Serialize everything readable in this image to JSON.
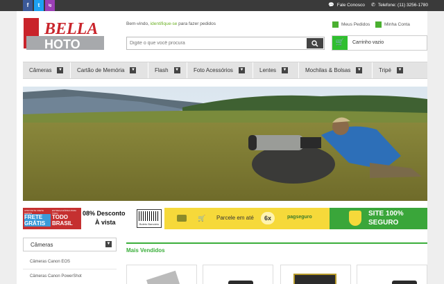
{
  "topbar": {
    "social": [
      "f",
      "t",
      "ig"
    ],
    "contact_label": "Fale Conosco",
    "phone_label": "Telefone: (11) 3256-1780"
  },
  "header": {
    "logo_text_top": "BELLA",
    "logo_text_bottom": "HOTO",
    "welcome_prefix": "Bem-vindo,",
    "welcome_link": "identifique-se",
    "welcome_suffix": "para fazer pedidos",
    "search_placeholder": "Digite o que você procura",
    "my_orders": "Meus Pedidos",
    "my_account": "Minha Conta",
    "cart_label": "Carrinho vazio"
  },
  "nav": {
    "items": [
      "Câmeras",
      "Cartão de Memória",
      "Flash",
      "Foto Acessórios",
      "Lentes",
      "Mochilas & Bolsas",
      "Tripé"
    ]
  },
  "strip": {
    "frete_top": "APROVEITE FRETE GRÁTIS",
    "frete": "FRETE GRÁTIS",
    "brasil_top": "ENTREGA RÁPIDA PARA TODO",
    "brasil": "TODO BRASIL",
    "desconto": "08% Desconto",
    "avista": "À vista",
    "boleto": "Boleto Bancário",
    "parcele": "Parcele em até",
    "parcelas": "6x",
    "pagseguro": "pagseguro",
    "site_line1": "SITE 100%",
    "site_line2": "SEGURO"
  },
  "sidebar": {
    "title": "Câmeras",
    "items": [
      "Câmeras Canon EOS",
      "Câmeras Canon PowerShot"
    ]
  },
  "products": {
    "title": "Mais Vendidos"
  }
}
